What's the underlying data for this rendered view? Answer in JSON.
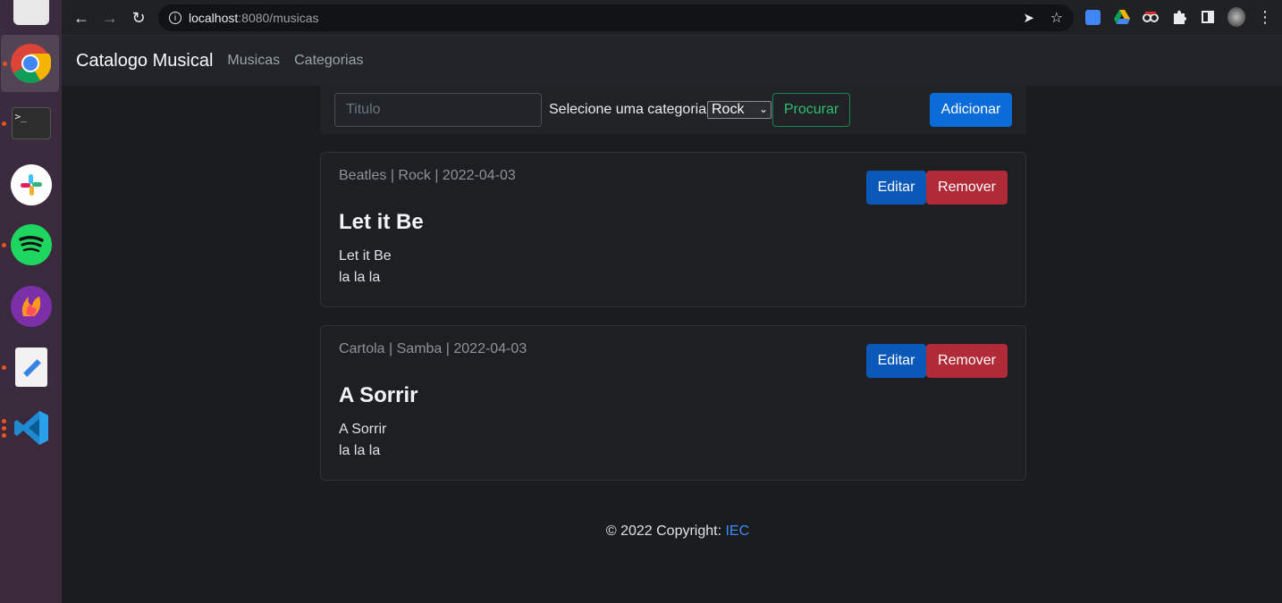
{
  "browser": {
    "url_host": "localhost",
    "url_path": ":8080/musicas"
  },
  "navbar": {
    "brand": "Catalogo Musical",
    "links": [
      "Musicas",
      "Categorias"
    ]
  },
  "search": {
    "title_placeholder": "Titulo",
    "category_label": "Selecione uma categoria",
    "category_selected": "Rock",
    "search_button": "Procurar",
    "add_button": "Adicionar"
  },
  "songs": [
    {
      "meta": "Beatles | Rock | 2022-04-03",
      "title": "Let it Be",
      "lines": [
        "Let it Be",
        "la la la"
      ],
      "edit_label": "Editar",
      "remove_label": "Remover"
    },
    {
      "meta": "Cartola | Samba | 2022-04-03",
      "title": "A Sorrir",
      "lines": [
        "A Sorrir",
        "la la la"
      ],
      "edit_label": "Editar",
      "remove_label": "Remover"
    }
  ],
  "footer": {
    "text": "© 2022 Copyright: ",
    "link": "IEC"
  },
  "colors": {
    "primary": "#0b6bd8",
    "danger": "#b02a37",
    "success": "#198754",
    "link": "#3d8bfd"
  }
}
